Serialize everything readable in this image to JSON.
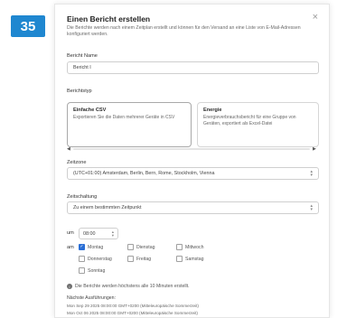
{
  "step_number": "35",
  "dialog": {
    "title": "Einen Bericht erstellen",
    "close_icon": "×",
    "description": "Die Berichte werden nach einem Zeitplan erstellt und können für den Versand an eine Liste von E-Mail-Adressen konfiguriert werden.",
    "report_name_label": "Bericht Name",
    "report_name_value": "Bericht I",
    "report_type_label": "Berichtstyp",
    "report_types": [
      {
        "title": "Einfache CSV",
        "description": "Exportieren Sie die Daten mehrerer Geräte in CSV"
      },
      {
        "title": "Energie",
        "description": "Energieverbrauchsbericht für eine Gruppe von Geräten, exportiert als Excel-Datei"
      }
    ],
    "scroll_left": "◀",
    "scroll_right": "▶",
    "timezone_label": "Zeitzone",
    "timezone_value": "(UTC+01:00) Amsterdam, Berlin, Bern, Rome, Stockholm, Vienna",
    "schedule_label": "Zeitschaltung",
    "schedule_value": "Zu einem bestimmten Zeitpunkt",
    "time_prefix": "um",
    "time_value": "08:00",
    "days_prefix": "am",
    "days": [
      {
        "label": "Montag",
        "checked": true
      },
      {
        "label": "Dienstag",
        "checked": false
      },
      {
        "label": "Mittwoch",
        "checked": false
      },
      {
        "label": "Donnerstag",
        "checked": false
      },
      {
        "label": "Freitag",
        "checked": false
      },
      {
        "label": "Samstag",
        "checked": false
      },
      {
        "label": "Sonntag",
        "checked": false
      }
    ],
    "info_text": "Die Berichte werden höchstens alle 10 Minuten erstellt.",
    "next_runs_label": "Nächste Ausführungen:",
    "next_runs": [
      "Mon Sep 29 2025 08:00:00 GMT+0200 (Mitteleuropäische Sommerzeit)",
      "Mon Oct 06 2025 08:00:00 GMT+0200 (Mitteleuropäische Sommerzeit)"
    ]
  },
  "colors": {
    "badge": "#1f87d0",
    "checkbox_checked": "#2b6fd6"
  }
}
